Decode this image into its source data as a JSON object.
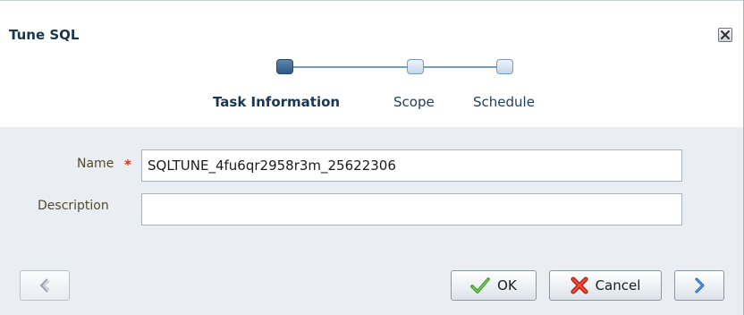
{
  "dialog": {
    "title": "Tune SQL",
    "close_icon": "close-icon"
  },
  "train": {
    "steps": [
      {
        "label": "Task Information",
        "state": "active"
      },
      {
        "label": "Scope",
        "state": "inactive"
      },
      {
        "label": "Schedule",
        "state": "inactive"
      }
    ]
  },
  "form": {
    "name_label": "Name",
    "name_required_mark": "*",
    "name_value": "SQLTUNE_4fu6qr2958r3m_25622306",
    "description_label": "Description",
    "description_value": ""
  },
  "footer": {
    "back_icon": "chevron-left-icon",
    "ok_label": "OK",
    "ok_icon": "checkmark-icon",
    "cancel_label": "Cancel",
    "cancel_icon": "red-x-icon",
    "next_icon": "chevron-right-icon"
  },
  "colors": {
    "title": "#1b3650",
    "active_step": "#2e5a84",
    "inactive_step": "#c4d6ea",
    "required": "#d33a1f",
    "form_bg": "#eaeef3"
  }
}
